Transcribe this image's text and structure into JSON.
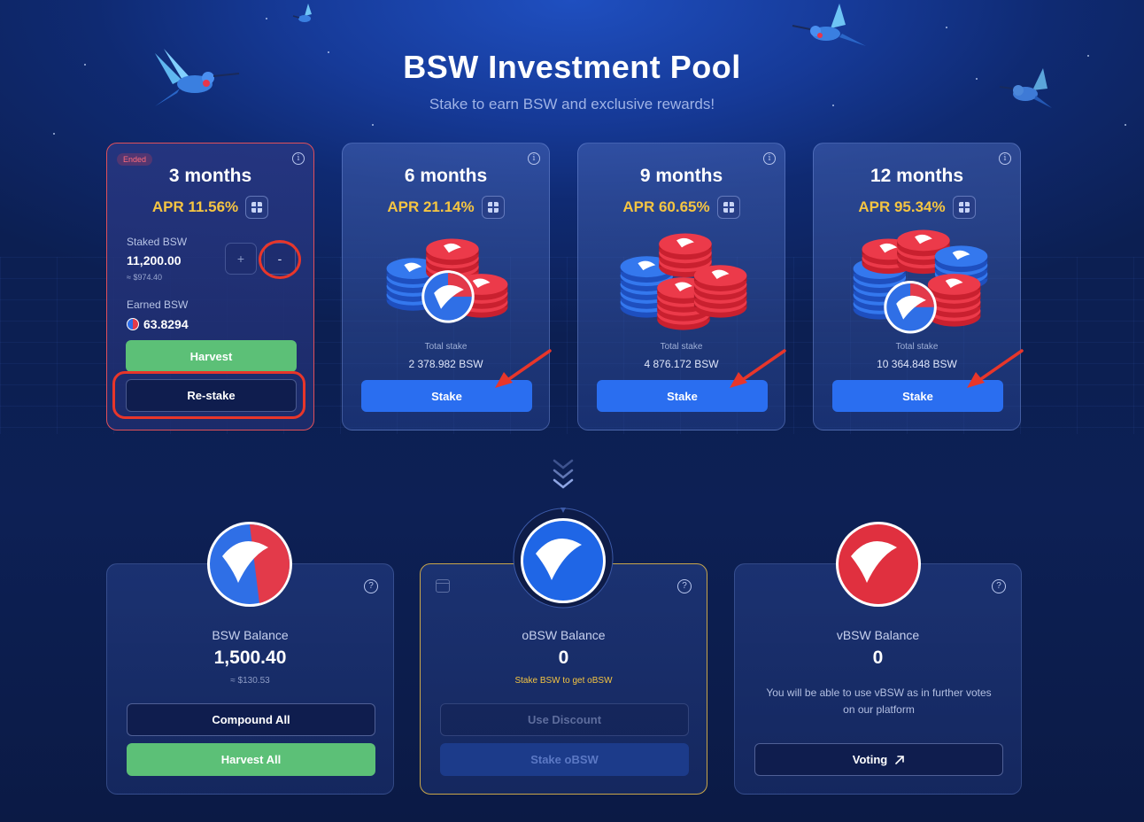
{
  "header": {
    "title": "BSW Investment Pool",
    "subtitle": "Stake to earn BSW and exclusive rewards!"
  },
  "pools": [
    {
      "badge": "Ended",
      "title": "3 months",
      "apr": "APR 11.56%",
      "staked_label": "Staked BSW",
      "staked_value": "11,200.00",
      "staked_usd": "≈ $974.40",
      "plus_label": "+",
      "minus_label": "-",
      "earned_label": "Earned BSW",
      "earned_value": "63.8294",
      "harvest_label": "Harvest",
      "restake_label": "Re-stake"
    },
    {
      "title": "6 months",
      "apr": "APR 21.14%",
      "total_label": "Total stake",
      "total_value": "2 378.982 BSW",
      "stake_label": "Stake"
    },
    {
      "title": "9 months",
      "apr": "APR 60.65%",
      "total_label": "Total stake",
      "total_value": "4 876.172 BSW",
      "stake_label": "Stake"
    },
    {
      "title": "12 months",
      "apr": "APR 95.34%",
      "total_label": "Total stake",
      "total_value": "10 364.848 BSW",
      "stake_label": "Stake"
    }
  ],
  "balances": [
    {
      "label": "BSW Balance",
      "value": "1,500.40",
      "usd": "≈ $130.53",
      "compound_label": "Compound All",
      "harvest_all_label": "Harvest All"
    },
    {
      "label": "oBSW Balance",
      "value": "0",
      "hint": "Stake BSW to get oBSW",
      "use_discount_label": "Use Discount",
      "stake_obsw_label": "Stake oBSW"
    },
    {
      "label": "vBSW Balance",
      "value": "0",
      "description": "You will be able to use vBSW as in further votes on our platform",
      "voting_label": "Voting"
    }
  ],
  "colors": {
    "accent_blue": "#2a6ef0",
    "apr_gold": "#f5c542",
    "harvest_green": "#5cc077",
    "ended_red": "#e0505a",
    "highlight_red": "#e8362a"
  },
  "icons": {
    "info": "info-icon",
    "calculator": "calculator-icon",
    "help": "question-icon",
    "calendar": "calendar-icon",
    "external": "arrow-up-right-icon",
    "chevrons": "chevrons-down-icon"
  }
}
